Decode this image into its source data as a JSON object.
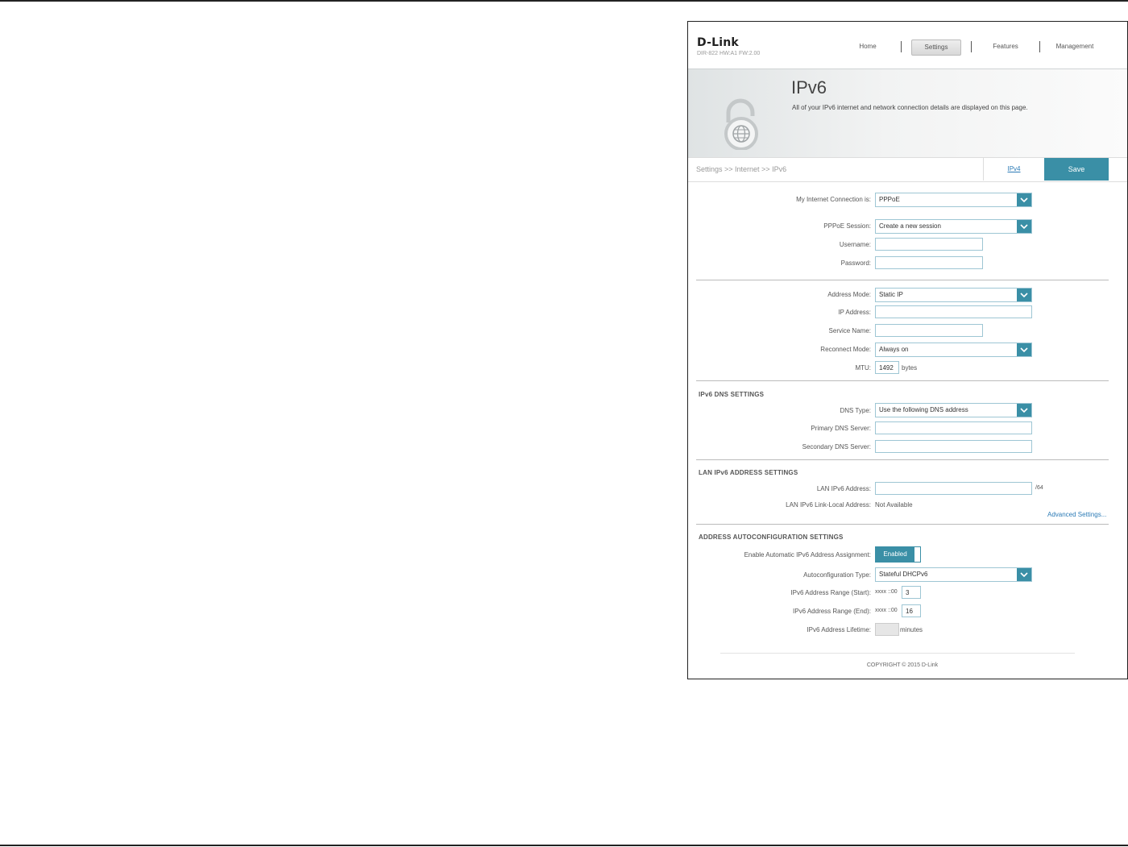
{
  "header": {
    "logo": "D-Link",
    "firmware": "DIR-822 HW:A1 FW:2.00",
    "nav": [
      "Home",
      "Settings",
      "Features",
      "Management"
    ],
    "active_nav": "Settings"
  },
  "banner": {
    "title": "IPv6",
    "description": "All of your IPv6 internet and network connection details are displayed on this page."
  },
  "breadcrumb": "Settings >> Internet >> IPv6",
  "tabs": {
    "ipv4": "IPv4",
    "save": "Save"
  },
  "connection": {
    "label": "My Internet Connection is:",
    "value": "PPPoE"
  },
  "pppoe": {
    "session_label": "PPPoE Session:",
    "session_value": "Create a new session",
    "username_label": "Username:",
    "username_value": "",
    "password_label": "Password:",
    "password_value": ""
  },
  "address": {
    "mode_label": "Address Mode:",
    "mode_value": "Static IP",
    "ip_label": "IP Address:",
    "ip_value": "",
    "service_label": "Service Name:",
    "service_value": "",
    "reconnect_label": "Reconnect Mode:",
    "reconnect_value": "Always on",
    "mtu_label": "MTU:",
    "mtu_value": "1492",
    "mtu_unit": "bytes"
  },
  "dns": {
    "section": "IPv6 DNS SETTINGS",
    "type_label": "DNS Type:",
    "type_value": "Use the following DNS address",
    "primary_label": "Primary DNS Server:",
    "primary_value": "",
    "secondary_label": "Secondary DNS Server:",
    "secondary_value": ""
  },
  "lan": {
    "section": "LAN IPv6 ADDRESS SETTINGS",
    "address_label": "LAN IPv6 Address:",
    "address_value": "",
    "prefix_suffix": "/64",
    "linklocal_label": "LAN IPv6 Link-Local Address:",
    "linklocal_value": "Not Available",
    "advanced_link": "Advanced Settings..."
  },
  "autoconfig": {
    "section": "ADDRESS AUTOCONFIGURATION SETTINGS",
    "enable_label": "Enable Automatic IPv6 Address Assignment:",
    "enable_value": "Enabled",
    "type_label": "Autoconfiguration Type:",
    "type_value": "Stateful DHCPv6",
    "range_start_label": "IPv6 Address Range (Start):",
    "range_start_prefix": "xxxx ::00",
    "range_start_value": "3",
    "range_end_label": "IPv6 Address Range (End):",
    "range_end_prefix": "xxxx ::00",
    "range_end_value": "16",
    "lifetime_label": "IPv6 Address Lifetime:",
    "lifetime_value": "",
    "lifetime_unit": "minutes"
  },
  "footer": {
    "copyright": "COPYRIGHT © 2015 D-Link"
  },
  "colors": {
    "accent": "#3a8fa6",
    "link": "#2c7bb6"
  }
}
